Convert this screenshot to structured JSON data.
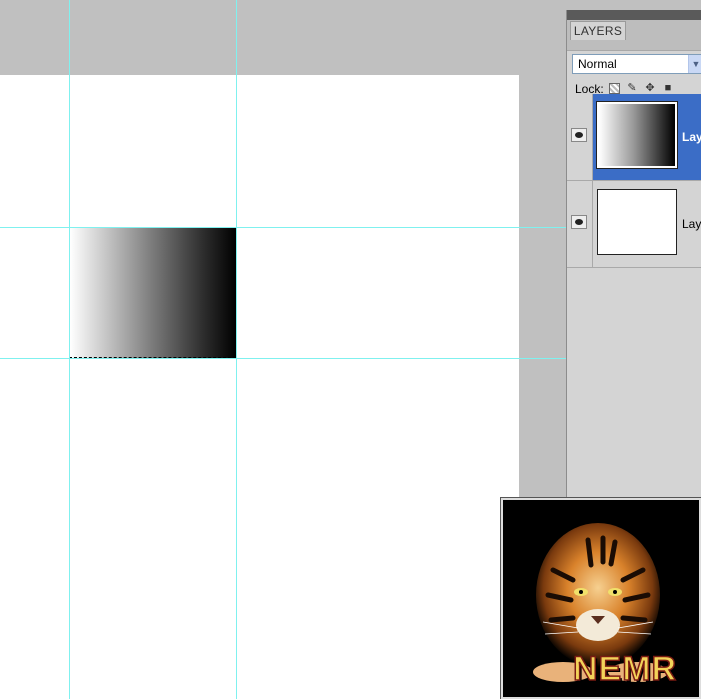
{
  "layers_panel": {
    "tab_label": "LAYERS",
    "blend_mode": "Normal",
    "lock_label": "Lock:",
    "lock_icons": [
      "lock-transparent-icon",
      "lock-paint-icon",
      "lock-move-icon",
      "lock-all-icon"
    ],
    "layers": [
      {
        "name": "Lay",
        "selected": true,
        "thumbnail": "gradient"
      },
      {
        "name": "Lay",
        "selected": false,
        "thumbnail": "white"
      }
    ]
  },
  "canvas": {
    "guide_color": "#7ff1ef",
    "gradient_stops": [
      "#ffffff",
      "#000000"
    ]
  },
  "colors": {
    "workspace_bg": "#c0c0c0",
    "selected_layer": "#3b6dc6",
    "panel_bg": "#d4d4d4"
  },
  "watermark": {
    "text": "NEMR"
  }
}
